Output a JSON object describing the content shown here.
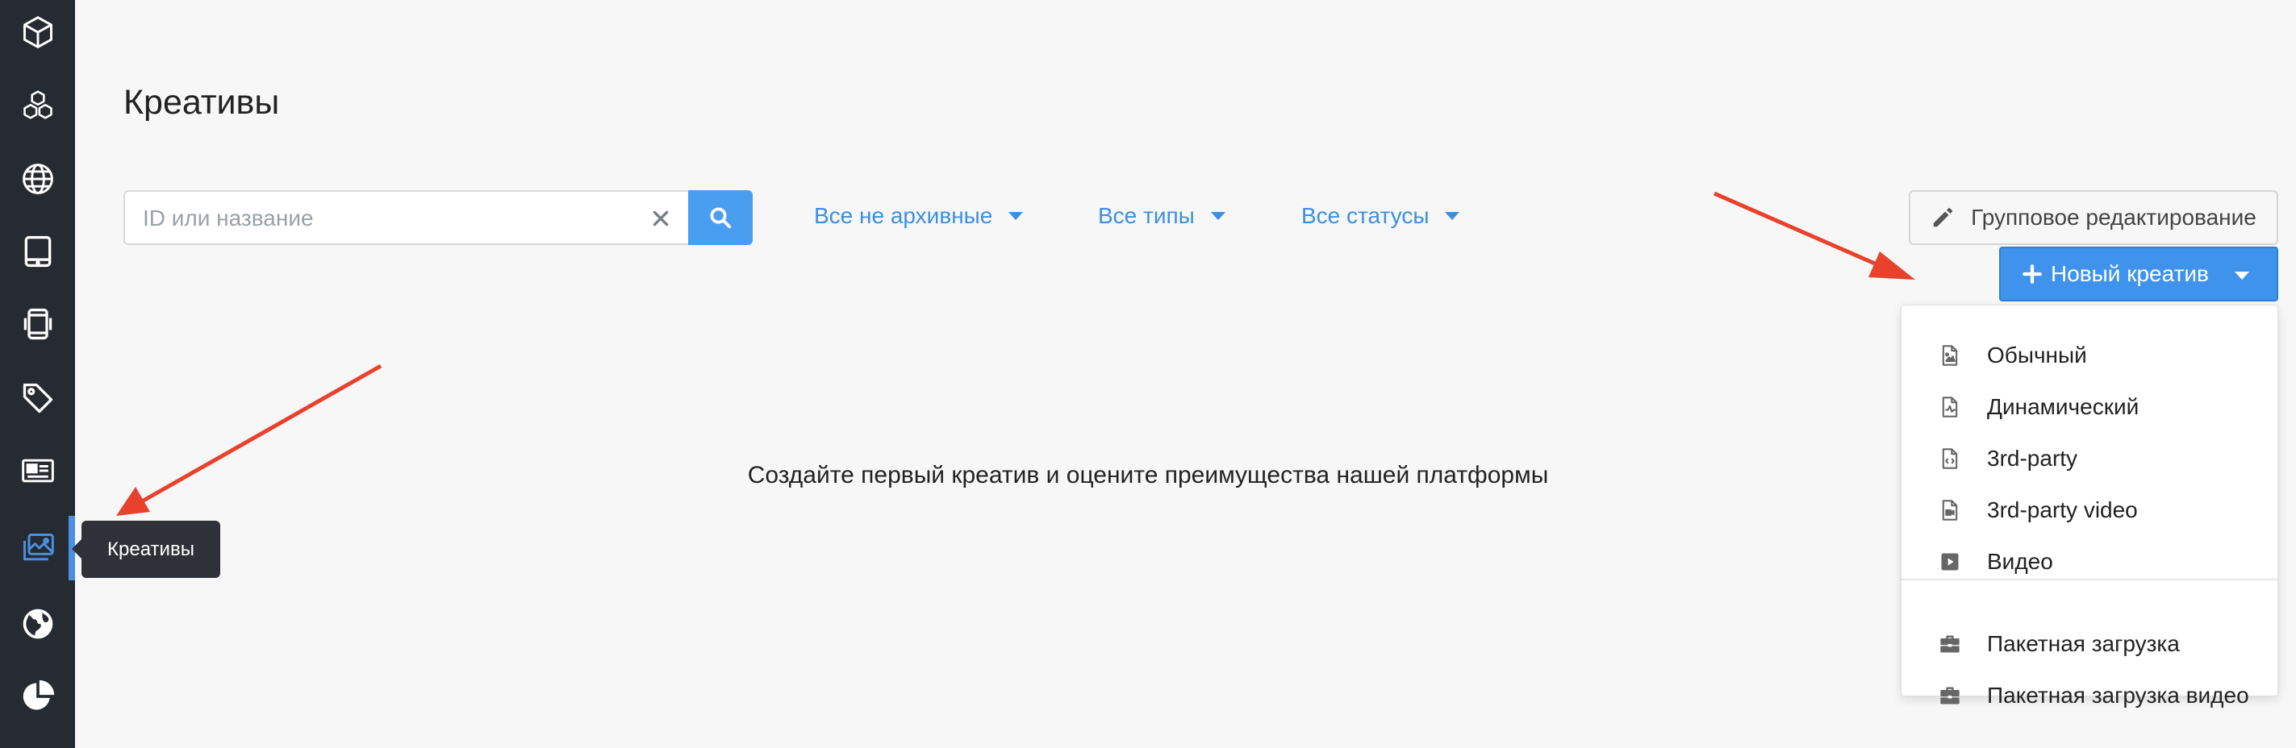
{
  "sidebar": {
    "items": [
      {
        "icon": "box-icon"
      },
      {
        "icon": "boxes-icon"
      },
      {
        "icon": "globe-icon"
      },
      {
        "icon": "tablet-icon"
      },
      {
        "icon": "mobile-icon"
      },
      {
        "icon": "tag-icon"
      },
      {
        "icon": "newspaper-icon"
      },
      {
        "icon": "images-icon",
        "active": true
      },
      {
        "icon": "globe-earth-icon"
      },
      {
        "icon": "pie-chart-icon"
      }
    ],
    "tooltip": "Креативы",
    "active_color": "#4a90e2"
  },
  "page": {
    "title": "Креативы"
  },
  "search": {
    "placeholder": "ID или название"
  },
  "filters": {
    "archive": "Все не архивные",
    "types": "Все типы",
    "statuses": "Все статусы"
  },
  "toolbar": {
    "bulk_edit_label": "Групповое редактирование",
    "new_creative_label": "Новый креатив"
  },
  "dropdown": {
    "items": [
      {
        "label": "Обычный",
        "icon": "file-image-icon"
      },
      {
        "label": "Динамический",
        "icon": "file-dynamic-icon"
      },
      {
        "label": "3rd-party",
        "icon": "file-code-icon"
      },
      {
        "label": "3rd-party video",
        "icon": "file-video-icon"
      },
      {
        "label": "Видео",
        "icon": "play-square-icon"
      },
      {
        "label": "Пакетная загрузка",
        "icon": "briefcase-icon"
      },
      {
        "label": "Пакетная загрузка видео",
        "icon": "briefcase-icon"
      }
    ]
  },
  "empty_state": {
    "message": "Создайте первый креатив и оцените преимущества нашей платформы"
  },
  "colors": {
    "sidebar_bg": "#262a31",
    "accent": "#3f93ec",
    "link": "#3d8fe0",
    "annotation_arrow": "#e8412c"
  }
}
